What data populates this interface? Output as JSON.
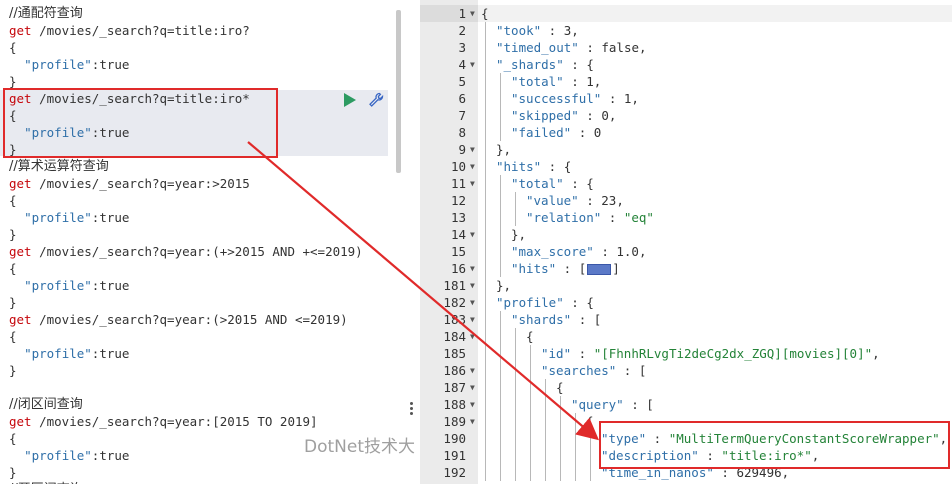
{
  "console": {
    "lines": [
      {
        "type": "comment",
        "text": "//通配符查询"
      },
      {
        "type": "req",
        "method": "get",
        "path": " /movies/_search?q=title:iro?"
      },
      {
        "type": "plain",
        "text": "{"
      },
      {
        "type": "prop",
        "key": "\"profile\"",
        "rest": ":true"
      },
      {
        "type": "plain",
        "text": "}"
      },
      {
        "type": "req",
        "method": "get",
        "path": " /movies/_search?q=title:iro*"
      },
      {
        "type": "plain",
        "text": "{"
      },
      {
        "type": "prop",
        "key": "\"profile\"",
        "rest": ":true"
      },
      {
        "type": "plain",
        "text": "}"
      },
      {
        "type": "comment",
        "text": "//算术运算符查询"
      },
      {
        "type": "req",
        "method": "get",
        "path": " /movies/_search?q=year:>2015"
      },
      {
        "type": "plain",
        "text": "{"
      },
      {
        "type": "prop",
        "key": "\"profile\"",
        "rest": ":true"
      },
      {
        "type": "plain",
        "text": "}"
      },
      {
        "type": "req",
        "method": "get",
        "path": " /movies/_search?q=year:(+>2015 AND +<=2019)"
      },
      {
        "type": "plain",
        "text": "{"
      },
      {
        "type": "prop",
        "key": "\"profile\"",
        "rest": ":true"
      },
      {
        "type": "plain",
        "text": "}"
      },
      {
        "type": "req",
        "method": "get",
        "path": " /movies/_search?q=year:(>2015 AND <=2019)"
      },
      {
        "type": "plain",
        "text": "{"
      },
      {
        "type": "prop",
        "key": "\"profile\"",
        "rest": ":true"
      },
      {
        "type": "plain",
        "text": "}"
      },
      {
        "type": "plain",
        "text": ""
      },
      {
        "type": "comment",
        "text": "//闭区间查询"
      },
      {
        "type": "req",
        "method": "get",
        "path": " /movies/_search?q=year:[2015 TO 2019]"
      },
      {
        "type": "plain",
        "text": "{"
      },
      {
        "type": "prop",
        "key": "\"profile\"",
        "rest": ":true"
      },
      {
        "type": "plain",
        "text": "}"
      },
      {
        "type": "comment",
        "text": "//开区间查询"
      }
    ],
    "run_icon": "play-icon",
    "settings_icon": "wrench-icon"
  },
  "response": {
    "lines": [
      {
        "n": "1",
        "fold": true,
        "code": "{",
        "indent": 0
      },
      {
        "n": "2",
        "fold": false,
        "indent": 1,
        "key": "\"took\"",
        "sep": " : ",
        "val": "3",
        "vtype": "num",
        "tail": ","
      },
      {
        "n": "3",
        "fold": false,
        "indent": 1,
        "key": "\"timed_out\"",
        "sep": " : ",
        "val": "false",
        "vtype": "num",
        "tail": ","
      },
      {
        "n": "4",
        "fold": true,
        "indent": 1,
        "key": "\"_shards\"",
        "sep": " : ",
        "val": "{",
        "vtype": "plain",
        "tail": ""
      },
      {
        "n": "5",
        "fold": false,
        "indent": 2,
        "key": "\"total\"",
        "sep": " : ",
        "val": "1",
        "vtype": "num",
        "tail": ","
      },
      {
        "n": "6",
        "fold": false,
        "indent": 2,
        "key": "\"successful\"",
        "sep": " : ",
        "val": "1",
        "vtype": "num",
        "tail": ","
      },
      {
        "n": "7",
        "fold": false,
        "indent": 2,
        "key": "\"skipped\"",
        "sep": " : ",
        "val": "0",
        "vtype": "num",
        "tail": ","
      },
      {
        "n": "8",
        "fold": false,
        "indent": 2,
        "key": "\"failed\"",
        "sep": " : ",
        "val": "0",
        "vtype": "num",
        "tail": ""
      },
      {
        "n": "9",
        "fold": true,
        "indent": 1,
        "code": "},"
      },
      {
        "n": "10",
        "fold": true,
        "indent": 1,
        "key": "\"hits\"",
        "sep": " : ",
        "val": "{",
        "vtype": "plain",
        "tail": ""
      },
      {
        "n": "11",
        "fold": true,
        "indent": 2,
        "key": "\"total\"",
        "sep": " : ",
        "val": "{",
        "vtype": "plain",
        "tail": ""
      },
      {
        "n": "12",
        "fold": false,
        "indent": 3,
        "key": "\"value\"",
        "sep": " : ",
        "val": "23",
        "vtype": "num",
        "tail": ","
      },
      {
        "n": "13",
        "fold": false,
        "indent": 3,
        "key": "\"relation\"",
        "sep": " : ",
        "val": "\"eq\"",
        "vtype": "str",
        "tail": ""
      },
      {
        "n": "14",
        "fold": true,
        "indent": 2,
        "code": "},"
      },
      {
        "n": "15",
        "fold": false,
        "indent": 2,
        "key": "\"max_score\"",
        "sep": " : ",
        "val": "1.0",
        "vtype": "num",
        "tail": ","
      },
      {
        "n": "16",
        "fold": true,
        "indent": 2,
        "key": "\"hits\"",
        "sep": " : ",
        "val": "[",
        "vtype": "plain",
        "tail": "]",
        "pill": true
      },
      {
        "n": "181",
        "fold": true,
        "indent": 1,
        "code": "},"
      },
      {
        "n": "182",
        "fold": true,
        "indent": 1,
        "key": "\"profile\"",
        "sep": " : ",
        "val": "{",
        "vtype": "plain",
        "tail": ""
      },
      {
        "n": "183",
        "fold": true,
        "indent": 2,
        "key": "\"shards\"",
        "sep": " : ",
        "val": "[",
        "vtype": "plain",
        "tail": ""
      },
      {
        "n": "184",
        "fold": true,
        "indent": 3,
        "code": "{"
      },
      {
        "n": "185",
        "fold": false,
        "indent": 4,
        "key": "\"id\"",
        "sep": " : ",
        "val": "\"[FhnhRLvgTi2deCg2dx_ZGQ][movies][0]\"",
        "vtype": "str",
        "tail": ","
      },
      {
        "n": "186",
        "fold": true,
        "indent": 4,
        "key": "\"searches\"",
        "sep": " : ",
        "val": "[",
        "vtype": "plain",
        "tail": ""
      },
      {
        "n": "187",
        "fold": true,
        "indent": 5,
        "code": "{"
      },
      {
        "n": "188",
        "fold": true,
        "indent": 6,
        "key": "\"query\"",
        "sep": " : ",
        "val": "[",
        "vtype": "plain",
        "tail": ""
      },
      {
        "n": "189",
        "fold": true,
        "indent": 7,
        "code": "{"
      },
      {
        "n": "190",
        "fold": false,
        "indent": 8,
        "key": "\"type\"",
        "sep": " : ",
        "val": "\"MultiTermQueryConstantScoreWrapper\"",
        "vtype": "str",
        "tail": ","
      },
      {
        "n": "191",
        "fold": false,
        "indent": 8,
        "key": "\"description\"",
        "sep": " : ",
        "val": "\"title:iro*\"",
        "vtype": "str",
        "tail": ","
      },
      {
        "n": "192",
        "fold": false,
        "indent": 8,
        "key": "\"time_in_nanos\"",
        "sep": " : ",
        "val": "629496",
        "vtype": "num",
        "tail": ","
      }
    ]
  },
  "watermark": "DotNet技术大"
}
